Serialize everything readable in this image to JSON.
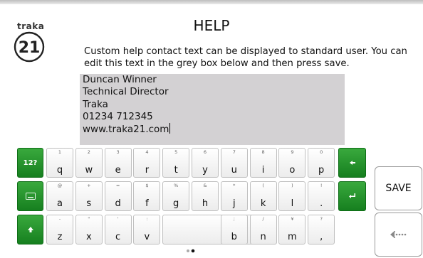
{
  "brand": "traka",
  "logo_number": "21",
  "title": "HELP",
  "description": "Custom help contact text can be displayed to standard user. You can edit this text in the grey box below and then press save.",
  "note_lines": [
    "Duncan Winner",
    "Technical Director",
    "Traka",
    "01234 712345",
    "www.traka21.com"
  ],
  "keyboard": {
    "mode_label": "12?",
    "row1": [
      {
        "p": "q",
        "s": "1"
      },
      {
        "p": "w",
        "s": "2"
      },
      {
        "p": "e",
        "s": "3"
      },
      {
        "p": "r",
        "s": "4"
      },
      {
        "p": "t",
        "s": "5"
      },
      {
        "p": "y",
        "s": "6"
      },
      {
        "p": "u",
        "s": "7"
      },
      {
        "p": "i",
        "s": "8"
      },
      {
        "p": "o",
        "s": "9"
      },
      {
        "p": "p",
        "s": "0"
      }
    ],
    "row2": [
      {
        "p": "a",
        "s": "@"
      },
      {
        "p": "s",
        "s": "+"
      },
      {
        "p": "d",
        "s": "="
      },
      {
        "p": "f",
        "s": "$"
      },
      {
        "p": "g",
        "s": "%"
      },
      {
        "p": "h",
        "s": "&"
      },
      {
        "p": "j",
        "s": "*"
      },
      {
        "p": "k",
        "s": "("
      },
      {
        "p": "l",
        "s": ")"
      },
      {
        "p": ".",
        "s": "!"
      }
    ],
    "row3_left": [
      {
        "p": "z",
        "s": "-"
      },
      {
        "p": "x",
        "s": "\""
      },
      {
        "p": "c",
        "s": "'"
      },
      {
        "p": "v",
        "s": ":"
      }
    ],
    "row3_right": [
      {
        "p": "b",
        "s": ";"
      },
      {
        "p": "n",
        "s": "/"
      },
      {
        "p": "m",
        "s": "¥"
      },
      {
        "p": ",",
        "s": "?"
      }
    ]
  },
  "save_label": "SAVE",
  "page_indicator": {
    "count": 2,
    "active": 1
  }
}
